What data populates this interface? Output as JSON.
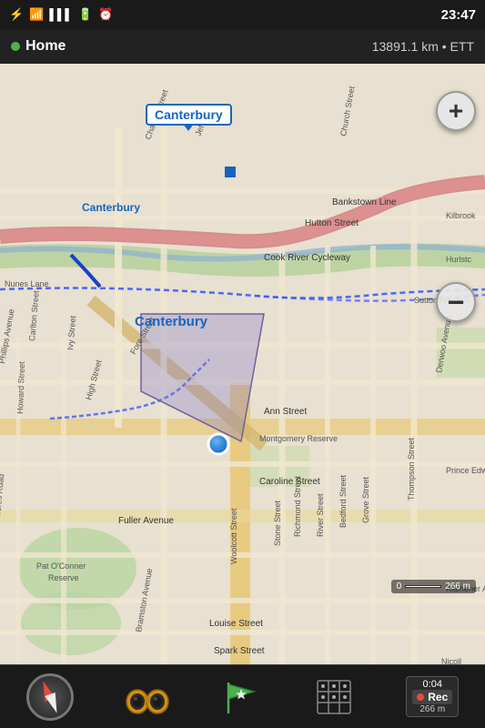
{
  "statusBar": {
    "time": "23:47",
    "icons": [
      "usb",
      "wifi",
      "signal",
      "battery",
      "alarm"
    ]
  },
  "topBar": {
    "homeLabel": "Home",
    "homeColor": "#4caf50",
    "infoText": "13891.1 km  •  ETT"
  },
  "map": {
    "centerLabel": "Canterbury",
    "popupLabel": "Canterbury",
    "streets": [
      "Charles Street",
      "Jeff",
      "Church Street",
      "Phillips Avenue",
      "Carlton Street",
      "Ivy Street",
      "Howard Street",
      "High Street",
      "Fore Street",
      "Ann Street",
      "Montgomery Reserve",
      "Caroline Street",
      "Fuller Avenue",
      "Pat O'Conner Reserve",
      "Bramston Avenue",
      "Woolcott Street",
      "Stone Street",
      "Richmond Street",
      "River Street",
      "Bedford Street",
      "Grove Street",
      "Thompson Street",
      "Louise Street",
      "Spark Street",
      "Bankstown Line",
      "Hutton Street",
      "Cook River Cycleway",
      "Sutton Reserve",
      "Nicoll",
      "Kilbrook",
      "Hurlstc",
      "Derwoo Avenue",
      "Prince Edward",
      "Kitchener A",
      "Nunes Lane",
      "Mores Road"
    ],
    "triangleColor": "rgba(130,120,200,0.35)",
    "pathColor": "#3d5afe",
    "dotColor": "#1a6fce"
  },
  "zoomIn": "+",
  "zoomOut": "−",
  "bottomBar": {
    "items": [
      {
        "id": "compass",
        "label": ""
      },
      {
        "id": "binoculars",
        "label": ""
      },
      {
        "id": "flag",
        "label": ""
      },
      {
        "id": "grid",
        "label": ""
      },
      {
        "id": "recording",
        "label": ""
      }
    ],
    "recording": {
      "time": "0:04",
      "label": "Rec",
      "distance": "266 m"
    }
  },
  "scaleBar": {
    "value": "266 m"
  }
}
